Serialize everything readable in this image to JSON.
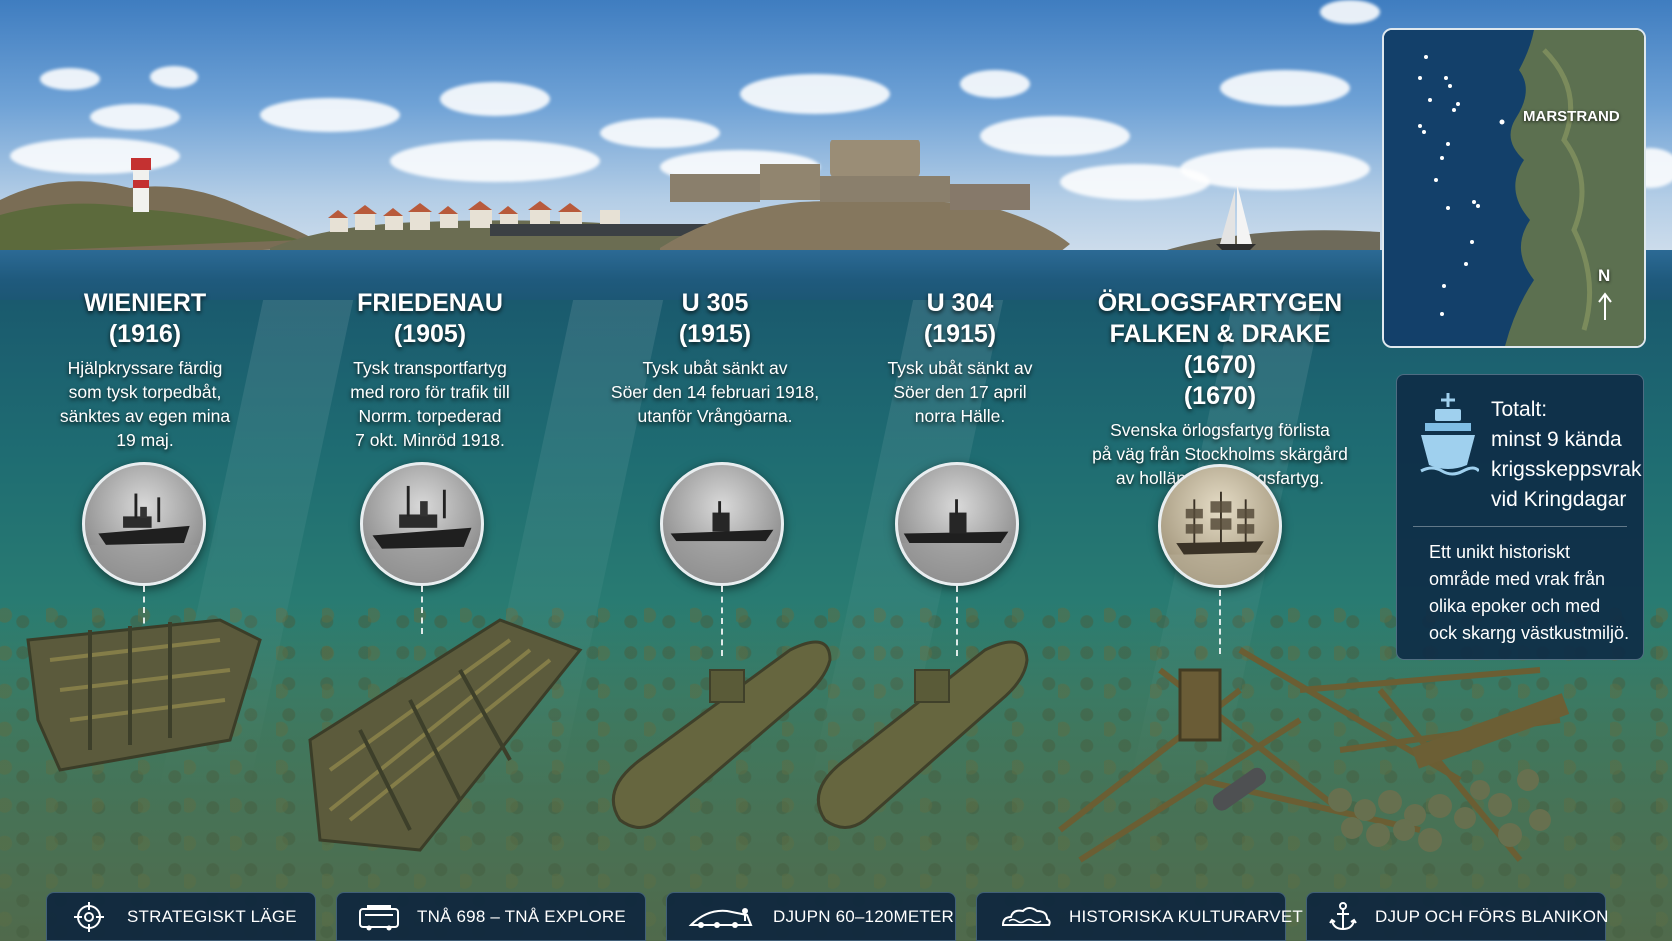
{
  "wrecks": [
    {
      "name": "WIENIERT",
      "year": "(1916)",
      "desc": [
        "Hjälpkryssare färdig",
        "som tysk torpedbåt,",
        "sänktes av egen mina",
        "19 maj."
      ]
    },
    {
      "name": "FRIEDENAU",
      "year": "(1905)",
      "desc": [
        "Tysk transportfartyg",
        "med roro för trafik till",
        "Norrm. torpederad",
        "7 okt. Minröd 1918."
      ]
    },
    {
      "name": "U 305",
      "year": "(1915)",
      "desc": [
        "Tysk ubåt sänkt av",
        "Söer den 14 februari 1918,",
        "utanför Vrångöarna."
      ]
    },
    {
      "name": "U 304",
      "year": "(1915)",
      "desc": [
        "Tysk ubåt sänkt av",
        "Söer den 17 april",
        "norra Hälle."
      ]
    },
    {
      "name": "ÖRLOGSFARTYGEN",
      "year": "FALKEN & DRAKE (1670)",
      "extra": "(1670)",
      "desc": [
        "Svenska örlogsfartyg förlista",
        "på väg från Stockholms skärgård",
        "av holländska örlogsfartyg."
      ]
    }
  ],
  "map": {
    "place_label": "MARSTRAND",
    "north_label": "N"
  },
  "summary": {
    "total_lines": [
      "Totalt:",
      "minst 9 kända",
      "krigsskeppsvrak",
      "vid Kringdagar"
    ],
    "desc_lines": [
      "Ett unikt historiskt",
      "område med vrak från",
      "olika epoker och med",
      "ock skarŋg västkustmiljö."
    ]
  },
  "bottom_bar": [
    {
      "icon": "crosshair-icon",
      "label": "STRATEGISKT LÄGE"
    },
    {
      "icon": "vehicle-icon",
      "label": "TNÅ 698 – TNÅ EXPLORE"
    },
    {
      "icon": "dive-boat-icon",
      "label": "DJUPN 60–120METER"
    },
    {
      "icon": "cloud-wave-icon",
      "label": "HISTORISKA KULTURARVET"
    },
    {
      "icon": "anchor-icon",
      "label": "DJUP OCH FÖRS BLANIKON"
    }
  ],
  "colors": {
    "panel": "#0e2c46",
    "water": "#1f6d72",
    "sky": "#6fa2d6"
  }
}
